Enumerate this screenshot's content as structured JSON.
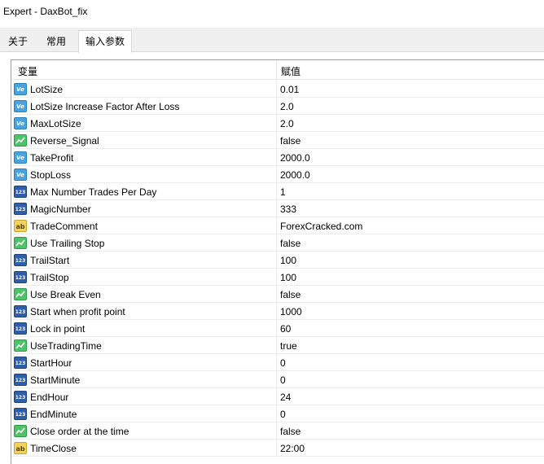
{
  "window": {
    "title": "Expert - DaxBot_fix"
  },
  "tabs": [
    {
      "label": "关于"
    },
    {
      "label": "常用"
    },
    {
      "label": "输入参数"
    }
  ],
  "grid": {
    "headers": {
      "name": "变量",
      "value": "赋值"
    },
    "rows": [
      {
        "icon": "ve",
        "name": "LotSize",
        "value": "0.01"
      },
      {
        "icon": "ve",
        "name": "LotSize Increase Factor After Loss",
        "value": "2.0"
      },
      {
        "icon": "ve",
        "name": "MaxLotSize",
        "value": "2.0"
      },
      {
        "icon": "bool",
        "name": "Reverse_Signal",
        "value": "false"
      },
      {
        "icon": "ve",
        "name": "TakeProfit",
        "value": "2000.0"
      },
      {
        "icon": "ve",
        "name": "StopLoss",
        "value": "2000.0"
      },
      {
        "icon": "num",
        "name": "Max Number Trades Per Day",
        "value": "1"
      },
      {
        "icon": "num",
        "name": "MagicNumber",
        "value": "333"
      },
      {
        "icon": "str",
        "name": "TradeComment",
        "value": "ForexCracked.com"
      },
      {
        "icon": "bool",
        "name": "Use Trailing Stop",
        "value": "false"
      },
      {
        "icon": "num",
        "name": "TrailStart",
        "value": "100"
      },
      {
        "icon": "num",
        "name": "TrailStop",
        "value": "100"
      },
      {
        "icon": "bool",
        "name": "Use Break Even",
        "value": "false"
      },
      {
        "icon": "num",
        "name": "Start when profit point",
        "value": "1000"
      },
      {
        "icon": "num",
        "name": "Lock in point",
        "value": "60"
      },
      {
        "icon": "bool",
        "name": "UseTradingTime",
        "value": "true"
      },
      {
        "icon": "num",
        "name": "StartHour",
        "value": "0"
      },
      {
        "icon": "num",
        "name": "StartMinute",
        "value": "0"
      },
      {
        "icon": "num",
        "name": "EndHour",
        "value": "24"
      },
      {
        "icon": "num",
        "name": "EndMinute",
        "value": "0"
      },
      {
        "icon": "bool",
        "name": "Close order at the time",
        "value": "false"
      },
      {
        "icon": "str",
        "name": "TimeClose",
        "value": "22:00"
      }
    ]
  },
  "icon_names": {
    "ve": "double-type-icon",
    "bool": "bool-type-icon",
    "num": "integer-type-icon",
    "str": "string-type-icon"
  },
  "icon_glyphs": {
    "ve": "Ve",
    "num": "123",
    "str": "ab"
  },
  "colors": {
    "double_icon": "#4aa3df",
    "bool_icon": "#4ec36a",
    "integer_icon": "#2f5fa8",
    "string_icon": "#f3d260"
  }
}
